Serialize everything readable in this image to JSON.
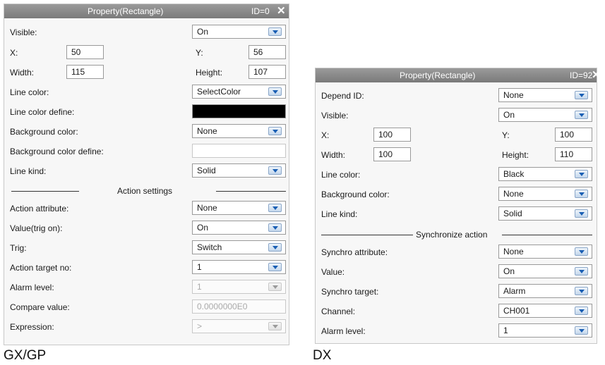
{
  "left_panel": {
    "title": "Property(Rectangle)",
    "id_label": "ID=0",
    "close_glyph": "✕",
    "visible_label": "Visible:",
    "visible_value": "On",
    "x_label": "X:",
    "x_value": "50",
    "y_label": "Y:",
    "y_value": "56",
    "width_label": "Width:",
    "width_value": "115",
    "height_label": "Height:",
    "height_value": "107",
    "line_color_label": "Line color:",
    "line_color_value": "SelectColor",
    "line_color_define_label": "Line color define:",
    "line_color_define_color": "#000000",
    "bg_color_label": "Background color:",
    "bg_color_value": "None",
    "bg_color_define_label": "Background color define:",
    "bg_color_define_color": "#ffffff",
    "line_kind_label": "Line kind:",
    "line_kind_value": "Solid",
    "section_title": "Action settings",
    "action_attribute_label": "Action attribute:",
    "action_attribute_value": "None",
    "value_trig_label": "Value(trig on):",
    "value_trig_value": "On",
    "trig_label": "Trig:",
    "trig_value": "Switch",
    "action_target_label": "Action target no:",
    "action_target_value": "1",
    "alarm_level_label": "Alarm level:",
    "alarm_level_value": "1",
    "compare_value_label": "Compare value:",
    "compare_value_value": "0.0000000E0",
    "expression_label": "Expression:",
    "expression_value": ">"
  },
  "right_panel": {
    "title": "Property(Rectangle)",
    "id_label": "ID=92",
    "close_glyph": "✕",
    "depend_id_label": "Depend ID:",
    "depend_id_value": "None",
    "visible_label": "Visible:",
    "visible_value": "On",
    "x_label": "X:",
    "x_value": "100",
    "y_label": "Y:",
    "y_value": "100",
    "width_label": "Width:",
    "width_value": "100",
    "height_label": "Height:",
    "height_value": "110",
    "line_color_label": "Line color:",
    "line_color_value": "Black",
    "bg_color_label": "Background color:",
    "bg_color_value": "None",
    "line_kind_label": "Line kind:",
    "line_kind_value": "Solid",
    "section_title": "Synchronize action",
    "synchro_attribute_label": "Synchro attribute:",
    "synchro_attribute_value": "None",
    "value_label": "Value:",
    "value_value": "On",
    "synchro_target_label": "Synchro target:",
    "synchro_target_value": "Alarm",
    "channel_label": "Channel:",
    "channel_value": "CH001",
    "alarm_level_label": "Alarm level:",
    "alarm_level_value": "1"
  },
  "captions": {
    "left": "GX/GP",
    "right": "DX"
  }
}
